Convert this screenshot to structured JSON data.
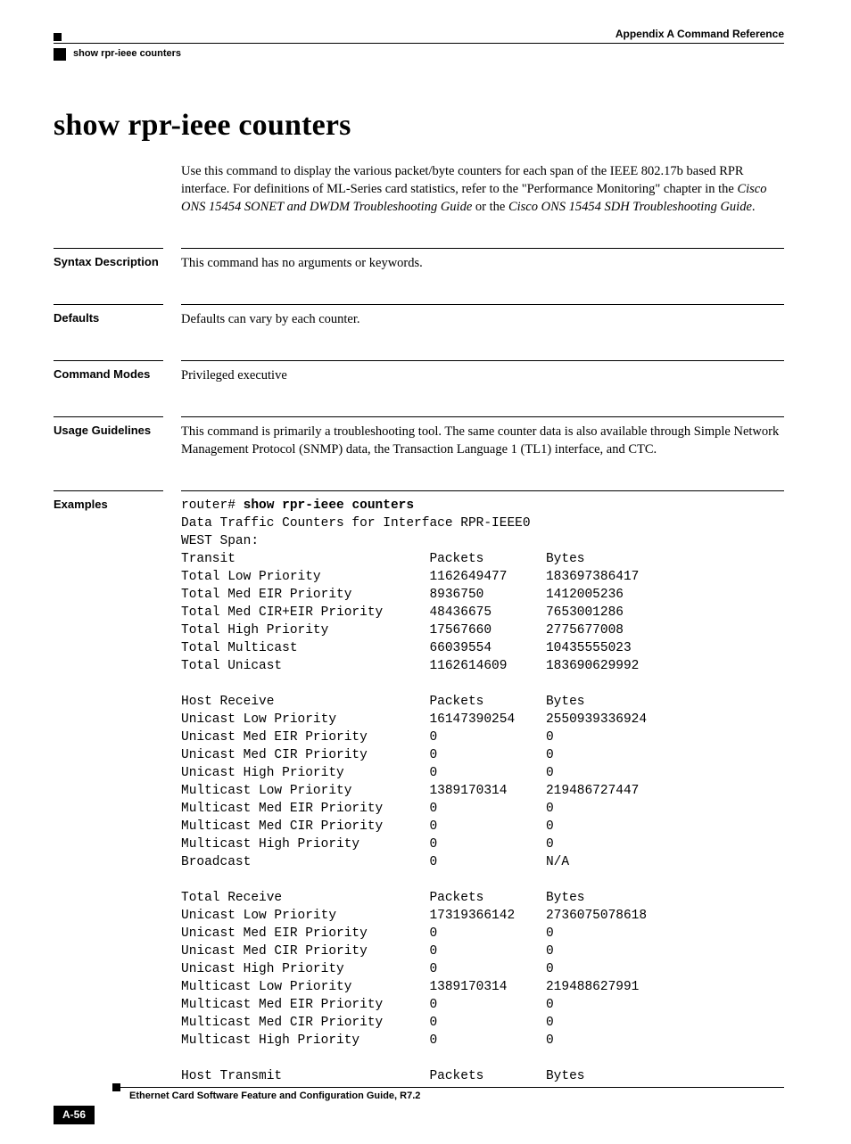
{
  "header": {
    "appendix_label": "Appendix A",
    "appendix_title": "Command Reference",
    "breadcrumb": "show rpr-ieee counters"
  },
  "title": "show rpr-ieee counters",
  "intro": {
    "text_before_italic1": "Use this command to display the various packet/byte counters for each span of the IEEE 802.17b based RPR interface. For definitions of ML-Series card statistics, refer to the \"Performance Monitoring\" chapter in the ",
    "italic1": "Cisco ONS 15454 SONET and DWDM Troubleshooting Guide",
    "mid": " or the ",
    "italic2": "Cisco ONS 15454 SDH Troubleshooting Guide",
    "after": "."
  },
  "sections": {
    "syntax": {
      "label": "Syntax Description",
      "body": "This command has no arguments or keywords."
    },
    "defaults": {
      "label": "Defaults",
      "body": "Defaults can vary by each counter."
    },
    "modes": {
      "label": "Command Modes",
      "body": "Privileged executive"
    },
    "usage": {
      "label": "Usage Guidelines",
      "body": "This command is primarily a troubleshooting tool. The same counter data is also available through Simple Network Management Protocol (SNMP) data, the Transaction Language 1 (TL1) interface, and CTC."
    },
    "examples": {
      "label": "Examples",
      "prompt": "router# ",
      "command": "show rpr-ieee counters",
      "interface_line": "Data Traffic Counters for Interface RPR-IEEE0",
      "span_line": "WEST Span:",
      "groups": [
        {
          "header": [
            "Transit",
            "Packets",
            "Bytes"
          ],
          "rows": [
            [
              "Total Low Priority",
              "1162649477",
              "183697386417"
            ],
            [
              "Total Med EIR Priority",
              "8936750",
              "1412005236"
            ],
            [
              "Total Med CIR+EIR Priority",
              "48436675",
              "7653001286"
            ],
            [
              "Total High Priority",
              "17567660",
              "2775677008"
            ],
            [
              "Total Multicast",
              "66039554",
              "10435555023"
            ],
            [
              "Total Unicast",
              "1162614609",
              "183690629992"
            ]
          ]
        },
        {
          "header": [
            "Host Receive",
            "Packets",
            "Bytes"
          ],
          "rows": [
            [
              "Unicast Low Priority",
              "16147390254",
              "2550939336924"
            ],
            [
              "Unicast Med EIR Priority",
              "0",
              "0"
            ],
            [
              "Unicast Med CIR Priority",
              "0",
              "0"
            ],
            [
              "Unicast High Priority",
              "0",
              "0"
            ],
            [
              "Multicast Low Priority",
              "1389170314",
              "219486727447"
            ],
            [
              "Multicast Med EIR Priority",
              "0",
              "0"
            ],
            [
              "Multicast Med CIR Priority",
              "0",
              "0"
            ],
            [
              "Multicast High Priority",
              "0",
              "0"
            ],
            [
              "Broadcast",
              "0",
              "N/A"
            ]
          ]
        },
        {
          "header": [
            "Total Receive",
            "Packets",
            "Bytes"
          ],
          "rows": [
            [
              "Unicast Low Priority",
              "17319366142",
              "2736075078618"
            ],
            [
              "Unicast Med EIR Priority",
              "0",
              "0"
            ],
            [
              "Unicast Med CIR Priority",
              "0",
              "0"
            ],
            [
              "Unicast High Priority",
              "0",
              "0"
            ],
            [
              "Multicast Low Priority",
              "1389170314",
              "219488627991"
            ],
            [
              "Multicast Med EIR Priority",
              "0",
              "0"
            ],
            [
              "Multicast Med CIR Priority",
              "0",
              "0"
            ],
            [
              "Multicast High Priority",
              "0",
              "0"
            ]
          ]
        },
        {
          "header": [
            "Host Transmit",
            "Packets",
            "Bytes"
          ],
          "rows": []
        }
      ]
    }
  },
  "footer": {
    "doc_title": "Ethernet Card Software Feature and Configuration Guide, R7.2",
    "page_num": "A-56"
  }
}
